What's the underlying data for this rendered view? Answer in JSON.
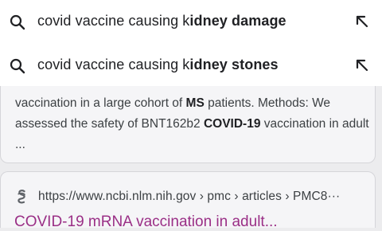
{
  "suggestions": [
    {
      "typed": "covid vaccine causing k",
      "completion": "idney damage"
    },
    {
      "typed": "covid vaccine causing k",
      "completion": "idney stones"
    }
  ],
  "result1": {
    "snippet": {
      "p1": "vaccination in a large cohort of ",
      "b1": "MS",
      "p2": " patients. Methods: We assessed the safety of BNT162b2 ",
      "b2": "COVID-19",
      "p3": " vaccination in adult ..."
    }
  },
  "result2": {
    "url": "https://www.ncbi.nlm.nih.gov › pmc › articles › PMC8···",
    "title_partial": "COVID-19 mRNA vaccination in adult..."
  },
  "colors": {
    "visited_link": "#9a2f86",
    "card_bg": "#f5f5f7",
    "page_bg": "#ececee"
  },
  "icons": {
    "suggestion_search": "search-icon",
    "suggestion_fill": "arrow-up-left-icon",
    "site_favicon": "ncbi-favicon"
  }
}
